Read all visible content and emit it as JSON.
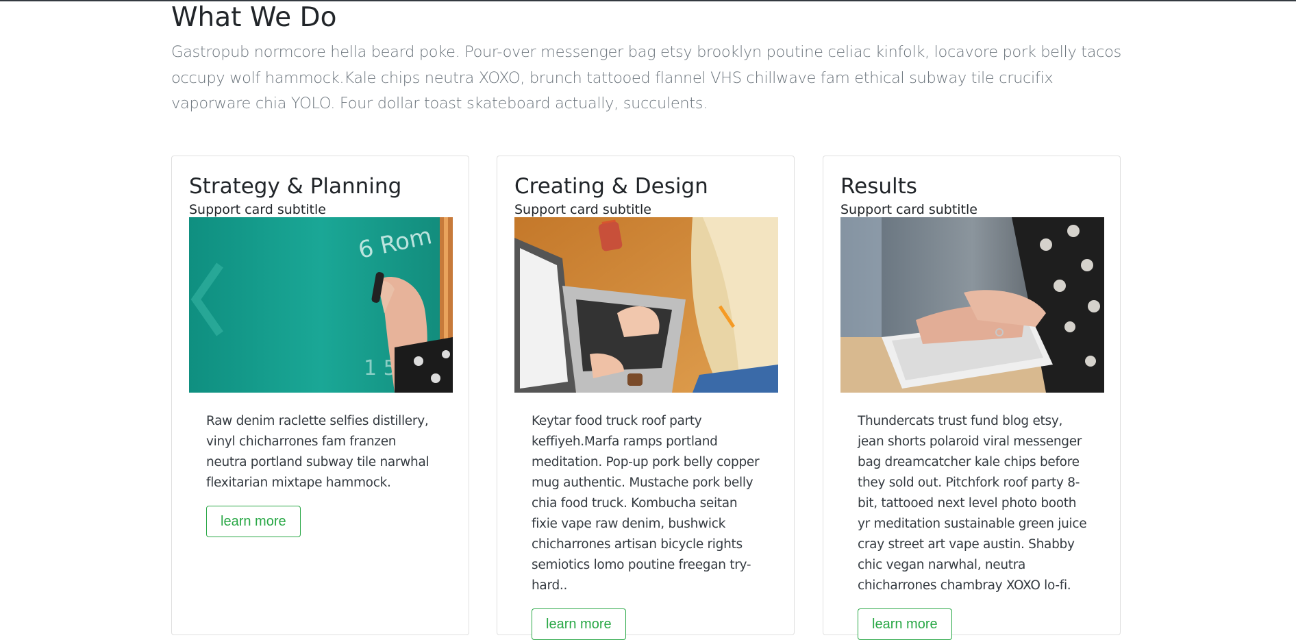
{
  "section": {
    "title": "What We Do",
    "lead": "Gastropub normcore hella beard poke. Pour-over messenger bag etsy brooklyn poutine celiac kinfolk, locavore pork belly tacos occupy wolf hammock.Kale chips neutra XOXO, brunch tattooed flannel VHS chillwave fam ethical subway tile crucifix vaporware chia YOLO. Four dollar toast skateboard actually, succulents."
  },
  "cards": [
    {
      "title": "Strategy & Planning",
      "subtitle": "Support card subtitle",
      "image": "chalkboard-writing-photo",
      "text": "Raw denim raclette selfies distillery, vinyl chicharrones fam franzen neutra portland subway tile narwhal flexitarian mixtape hammock.",
      "button": "learn more"
    },
    {
      "title": "Creating & Design",
      "subtitle": "Support card subtitle",
      "image": "laptop-typing-photo",
      "text": "Keytar food truck roof party keffiyeh.Marfa ramps portland meditation. Pop-up pork belly copper mug authentic. Mustache pork belly chia food truck. Kombucha seitan fixie vape raw denim, bushwick chicharrones artisan bicycle rights semiotics lomo poutine freegan try-hard..",
      "button": "learn more"
    },
    {
      "title": "Results",
      "subtitle": "Support card subtitle",
      "image": "keyboard-typing-photo",
      "text": "Thundercats trust fund blog etsy, jean shorts polaroid viral messenger bag dreamcatcher kale chips before they sold out. Pitchfork roof party 8-bit, tattooed next level photo booth yr meditation sustainable green juice cray street art vape austin. Shabby chic vegan narwhal, neutra chicharrones chambray XOXO lo-fi.",
      "button": "learn more"
    }
  ],
  "colors": {
    "accent": "#28a745",
    "lead_text": "#6c757d",
    "heading": "#212529"
  }
}
